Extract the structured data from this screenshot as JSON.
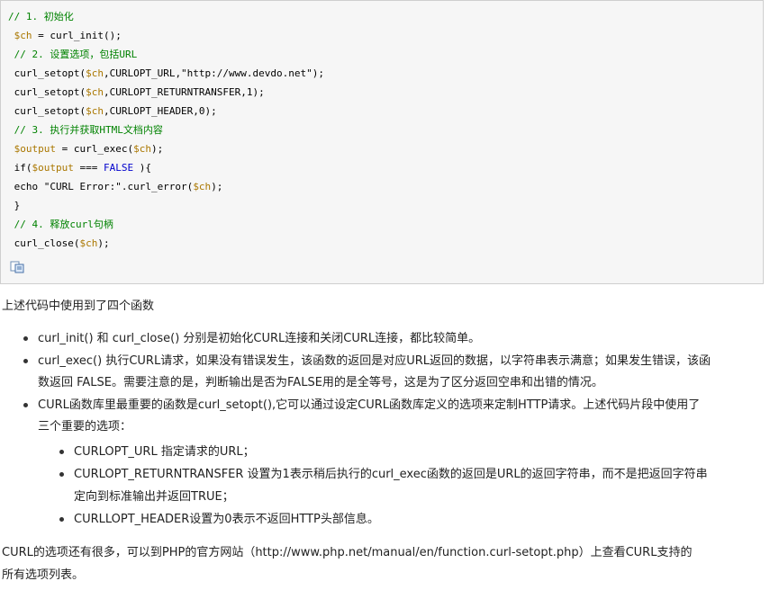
{
  "code": {
    "lines": [
      {
        "parts": [
          {
            "t": "// 1. 初始化",
            "c": "c"
          }
        ]
      },
      {
        "parts": [
          {
            "t": " ",
            "c": ""
          },
          {
            "t": "$ch",
            "c": "v"
          },
          {
            "t": " = curl_init();",
            "c": ""
          }
        ]
      },
      {
        "parts": [
          {
            "t": " // 2. 设置选项，包括URL",
            "c": "c"
          }
        ]
      },
      {
        "parts": [
          {
            "t": " curl_setopt(",
            "c": ""
          },
          {
            "t": "$ch",
            "c": "v"
          },
          {
            "t": ",CURLOPT_URL,\"http://www.devdo.net\");",
            "c": ""
          }
        ]
      },
      {
        "parts": [
          {
            "t": " curl_setopt(",
            "c": ""
          },
          {
            "t": "$ch",
            "c": "v"
          },
          {
            "t": ",CURLOPT_RETURNTRANSFER,1);",
            "c": ""
          }
        ]
      },
      {
        "parts": [
          {
            "t": " curl_setopt(",
            "c": ""
          },
          {
            "t": "$ch",
            "c": "v"
          },
          {
            "t": ",CURLOPT_HEADER,0);",
            "c": ""
          }
        ]
      },
      {
        "parts": [
          {
            "t": " // 3. 执行并获取HTML文档内容",
            "c": "c"
          }
        ]
      },
      {
        "parts": [
          {
            "t": " ",
            "c": ""
          },
          {
            "t": "$output",
            "c": "v"
          },
          {
            "t": " = curl_exec(",
            "c": ""
          },
          {
            "t": "$ch",
            "c": "v"
          },
          {
            "t": ");",
            "c": ""
          }
        ]
      },
      {
        "parts": [
          {
            "t": " if(",
            "c": ""
          },
          {
            "t": "$output",
            "c": "v"
          },
          {
            "t": " === ",
            "c": ""
          },
          {
            "t": "FALSE",
            "c": "k"
          },
          {
            "t": " ){",
            "c": ""
          }
        ]
      },
      {
        "parts": [
          {
            "t": " echo \"CURL Error:\".curl_error(",
            "c": ""
          },
          {
            "t": "$ch",
            "c": "v"
          },
          {
            "t": ");",
            "c": ""
          }
        ]
      },
      {
        "parts": [
          {
            "t": " }",
            "c": ""
          }
        ]
      },
      {
        "parts": [
          {
            "t": " // 4. 释放curl句柄",
            "c": "c"
          }
        ]
      },
      {
        "parts": [
          {
            "t": " curl_close(",
            "c": ""
          },
          {
            "t": "$ch",
            "c": "v"
          },
          {
            "t": ");",
            "c": ""
          }
        ]
      }
    ],
    "copy_icon": "copy-code-icon"
  },
  "body": {
    "intro": "上述代码中使用到了四个函数",
    "bullets": [
      {
        "lines": [
          "curl_init() 和 curl_close() 分别是初始化CURL连接和关闭CURL连接，都比较简单。"
        ]
      },
      {
        "lines": [
          "curl_exec() 执行CURL请求，如果没有错误发生，该函数的返回是对应URL返回的数据，以字符串表示满意；如果发生错误，该函",
          "数返回 FALSE。需要注意的是，判断输出是否为FALSE用的是全等号，这是为了区分返回空串和出错的情况。"
        ]
      },
      {
        "lines": [
          "CURL函数库里最重要的函数是curl_setopt(),它可以通过设定CURL函数库定义的选项来定制HTTP请求。上述代码片段中使用了",
          "三个重要的选项："
        ]
      }
    ],
    "sub_bullets": [
      {
        "lines": [
          "CURLOPT_URL 指定请求的URL；"
        ]
      },
      {
        "lines": [
          "CURLOPT_RETURNTRANSFER 设置为1表示稍后执行的curl_exec函数的返回是URL的返回字符串，而不是把返回字符串",
          "定向到标准输出并返回TRUE；"
        ]
      },
      {
        "lines": [
          "CURLLOPT_HEADER设置为0表示不返回HTTP头部信息。"
        ]
      }
    ],
    "outro": [
      "CURL的选项还有很多，可以到PHP的官方网站（http://www.php.net/manual/en/function.curl-setopt.php）上查看CURL支持的",
      "所有选项列表。"
    ]
  }
}
